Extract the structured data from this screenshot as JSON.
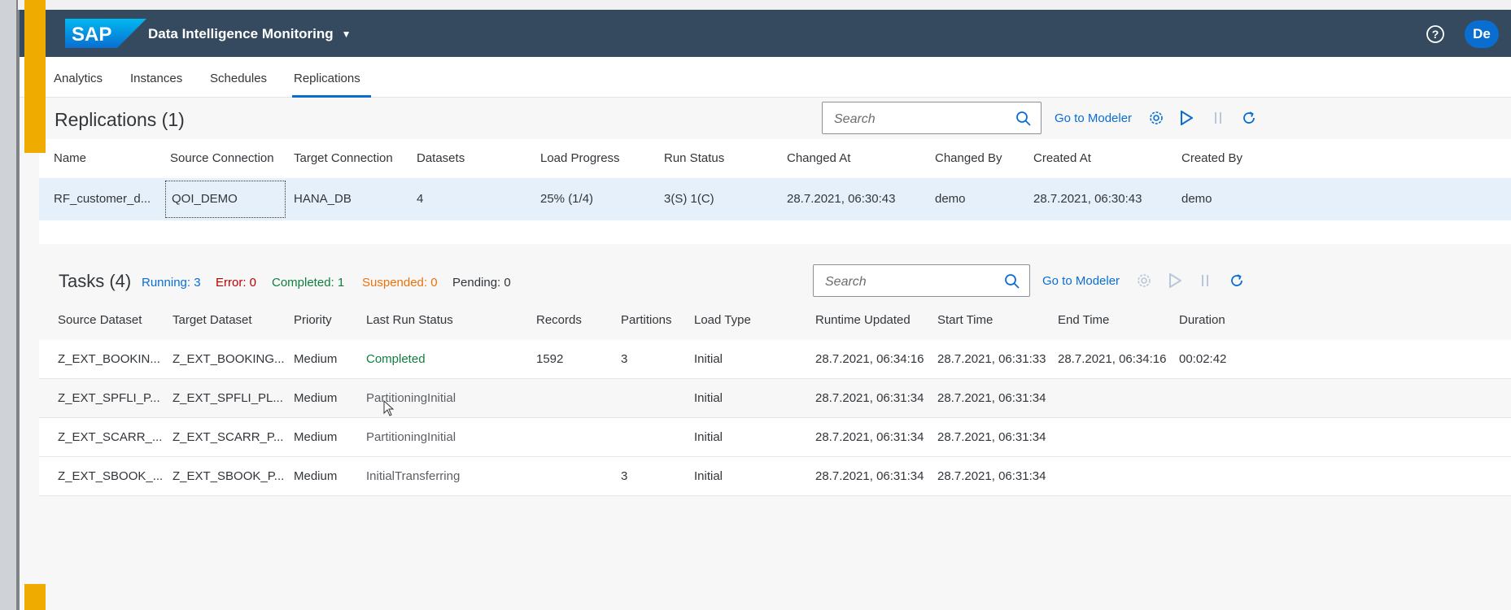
{
  "shell": {
    "logo": "SAP",
    "title": "Data Intelligence Monitoring",
    "avatar": "De"
  },
  "tabs": [
    "Analytics",
    "Instances",
    "Schedules",
    "Replications"
  ],
  "active_tab": "Replications",
  "replications": {
    "title": "Replications (1)",
    "search_placeholder": "Search",
    "go_to_modeler": "Go to Modeler",
    "columns": [
      "Name",
      "Source Connection",
      "Target Connection",
      "Datasets",
      "Load Progress",
      "Run Status",
      "Changed At",
      "Changed By",
      "Created At",
      "Created By"
    ],
    "rows": [
      [
        "RF_customer_d...",
        "QOI_DEMO",
        "HANA_DB",
        "4",
        "25% (1/4)",
        "3(S) 1(C)",
        "28.7.2021, 06:30:43",
        "demo",
        "28.7.2021, 06:30:43",
        "demo"
      ]
    ]
  },
  "tasks": {
    "title": "Tasks (4)",
    "status_counts": {
      "running": "Running: 3",
      "error": "Error: 0",
      "completed": "Completed: 1",
      "suspended": "Suspended: 0",
      "pending": "Pending: 0"
    },
    "search_placeholder": "Search",
    "go_to_modeler": "Go to Modeler",
    "columns": [
      "Source Dataset",
      "Target Dataset",
      "Priority",
      "Last Run Status",
      "Records",
      "Partitions",
      "Load Type",
      "Runtime Updated",
      "Start Time",
      "End Time",
      "Duration"
    ],
    "rows": [
      [
        "Z_EXT_BOOKIN...",
        "Z_EXT_BOOKING...",
        "Medium",
        "Completed",
        "1592",
        "3",
        "Initial",
        "28.7.2021, 06:34:16",
        "28.7.2021, 06:31:33",
        "28.7.2021, 06:34:16",
        "00:02:42"
      ],
      [
        "Z_EXT_SPFLI_P...",
        "Z_EXT_SPFLI_PL...",
        "Medium",
        "PartitioningInitial",
        "",
        "",
        "Initial",
        "28.7.2021, 06:31:34",
        "28.7.2021, 06:31:34",
        "",
        ""
      ],
      [
        "Z_EXT_SCARR_...",
        "Z_EXT_SCARR_P...",
        "Medium",
        "PartitioningInitial",
        "",
        "",
        "Initial",
        "28.7.2021, 06:31:34",
        "28.7.2021, 06:31:34",
        "",
        ""
      ],
      [
        "Z_EXT_SBOOK_...",
        "Z_EXT_SBOOK_P...",
        "Medium",
        "InitialTransferring",
        "",
        "3",
        "Initial",
        "28.7.2021, 06:31:34",
        "28.7.2021, 06:31:34",
        "",
        ""
      ]
    ]
  },
  "colors": {
    "shell": "#354a5f",
    "accent": "#0a6ed1",
    "highlight": "#f0ab00",
    "completed": "#107e3e",
    "error": "#bb0000",
    "suspended": "#e9730c"
  }
}
